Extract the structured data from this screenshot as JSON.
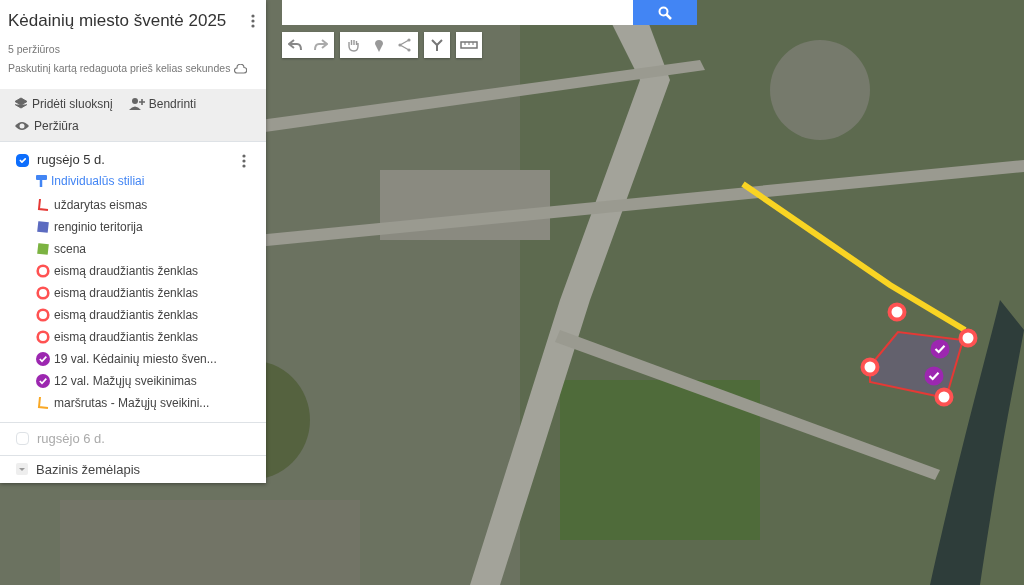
{
  "map_title": "Kėdainių miesto šventė 2025",
  "views": "5 peržiūros",
  "edited": "Paskutinį kartą redaguota prieš kelias sekundes",
  "actions": [
    {
      "kind": "layer",
      "label": "Pridėti sluoksnį"
    },
    {
      "kind": "share",
      "label": "Bendrinti"
    },
    {
      "kind": "preview",
      "label": "Peržiūra"
    }
  ],
  "layers": [
    {
      "name": "rugsėjo 5 d.",
      "checked": true,
      "style_link": "Individualūs stiliai",
      "items": [
        {
          "kind": "line",
          "label": "uždarytas eismas",
          "color": "#e53935"
        },
        {
          "kind": "polygon",
          "label": "renginio teritorija",
          "color": "#5c6bc0"
        },
        {
          "kind": "polygon",
          "label": "scena",
          "color": "#7cb342"
        },
        {
          "kind": "circle",
          "label": "eismą draudžiantis ženklas",
          "color": "#ff5252"
        },
        {
          "kind": "circle",
          "label": "eismą draudžiantis ženklas",
          "color": "#ff5252"
        },
        {
          "kind": "circle",
          "label": "eismą draudžiantis ženklas",
          "color": "#ff5252"
        },
        {
          "kind": "circle",
          "label": "eismą draudžiantis ženklas",
          "color": "#ff5252"
        },
        {
          "kind": "check",
          "label": "19 val. Kėdainių miesto šven...",
          "color": "#9c27b0"
        },
        {
          "kind": "check",
          "label": "12 val. Mažųjų sveikinimas",
          "color": "#9c27b0"
        },
        {
          "kind": "line",
          "label": "maršrutas - Mažųjų sveikini...",
          "color": "#f9a825"
        }
      ]
    },
    {
      "name": "rugsėjo 6 d.",
      "checked": false
    }
  ],
  "base_map": "Bazinis žemėlapis"
}
